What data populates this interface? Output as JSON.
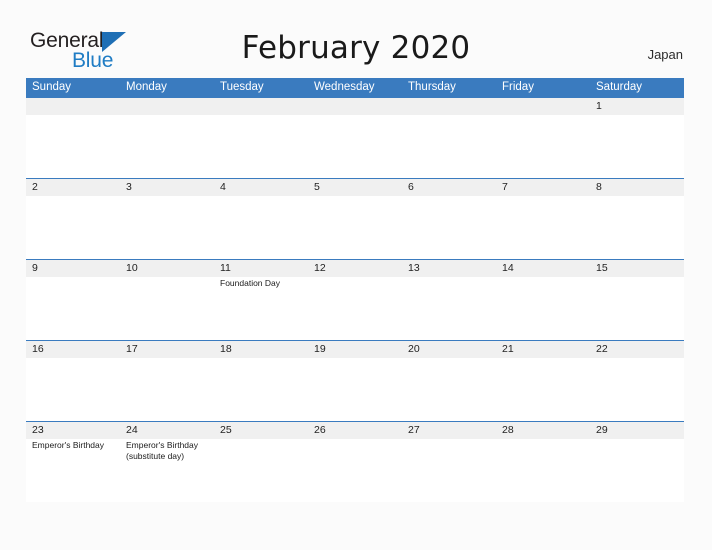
{
  "brand": {
    "name_part1": "General",
    "name_part2": "Blue",
    "triangle_icon": "triangle-icon",
    "accent_color": "#1f6fb5",
    "blue_text_color": "#1f7cc4"
  },
  "header": {
    "title": "February 2020",
    "country": "Japan"
  },
  "calendar": {
    "header_bg_color": "#3a7bbf",
    "date_band_color": "#f0f0f0",
    "weekdays": [
      "Sunday",
      "Monday",
      "Tuesday",
      "Wednesday",
      "Thursday",
      "Friday",
      "Saturday"
    ],
    "weeks": [
      {
        "dates": [
          "",
          "",
          "",
          "",
          "",
          "",
          "1"
        ],
        "events": [
          [],
          [],
          [],
          [],
          [],
          [],
          []
        ]
      },
      {
        "dates": [
          "2",
          "3",
          "4",
          "5",
          "6",
          "7",
          "8"
        ],
        "events": [
          [],
          [],
          [],
          [],
          [],
          [],
          []
        ]
      },
      {
        "dates": [
          "9",
          "10",
          "11",
          "12",
          "13",
          "14",
          "15"
        ],
        "events": [
          [],
          [],
          [
            "Foundation Day"
          ],
          [],
          [],
          [],
          []
        ]
      },
      {
        "dates": [
          "16",
          "17",
          "18",
          "19",
          "20",
          "21",
          "22"
        ],
        "events": [
          [],
          [],
          [],
          [],
          [],
          [],
          []
        ]
      },
      {
        "dates": [
          "23",
          "24",
          "25",
          "26",
          "27",
          "28",
          "29"
        ],
        "events": [
          [
            "Emperor's Birthday"
          ],
          [
            "Emperor's Birthday (substitute day)"
          ],
          [],
          [],
          [],
          [],
          []
        ]
      }
    ]
  }
}
